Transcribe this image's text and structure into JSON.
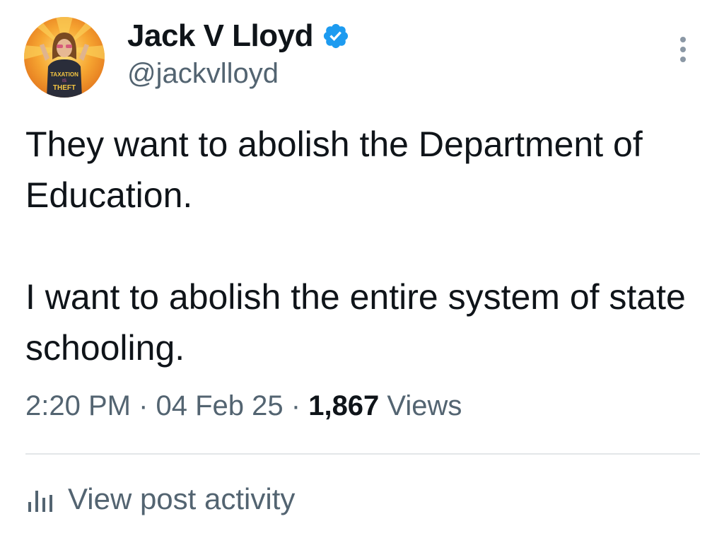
{
  "author": {
    "display_name": "Jack V Lloyd",
    "handle": "@jackvlloyd",
    "avatar_shirt_text": "TAXATION IS THEFT",
    "verified_icon": "verified-badge-icon",
    "verified_color": "#1d9bf0"
  },
  "post": {
    "text": "They want to abolish the Department of Education.\n\nI want to abolish the entire system of state schooling."
  },
  "meta": {
    "time": "2:20 PM",
    "sep1": " · ",
    "date": "04 Feb 25",
    "sep2": " · ",
    "views_count": "1,867",
    "views_label": " Views"
  },
  "actions": {
    "more_icon": "more-vertical-icon",
    "activity_icon": "bar-chart-icon",
    "activity_label": "View post activity"
  },
  "colors": {
    "primary_text": "#0f1419",
    "secondary_text": "#536471",
    "divider": "#e3e6e8"
  }
}
